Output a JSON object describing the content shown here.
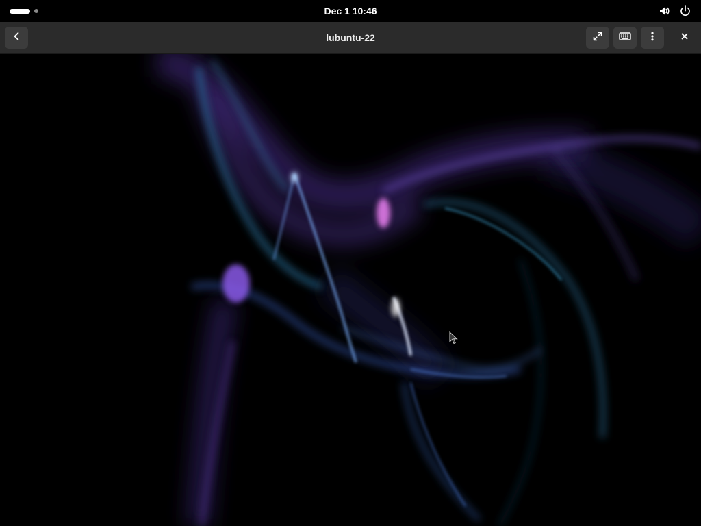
{
  "top_bar": {
    "clock": "Dec 1  10:46",
    "icons": [
      "volume-icon",
      "power-icon"
    ]
  },
  "header_bar": {
    "title": "lubuntu-22",
    "buttons": [
      "back-icon",
      "fullscreen-icon",
      "keyboard-icon",
      "kebab-menu-icon",
      "close-icon"
    ]
  },
  "remote_desktop": {
    "wallpaper": "abstract dark light-streak wallpaper",
    "colors": {
      "background": "#000000",
      "violet": "#7a4fc8",
      "magenta": "#c46ad8",
      "cyan": "#3aa0c8",
      "blue": "#5a6ad8"
    }
  }
}
